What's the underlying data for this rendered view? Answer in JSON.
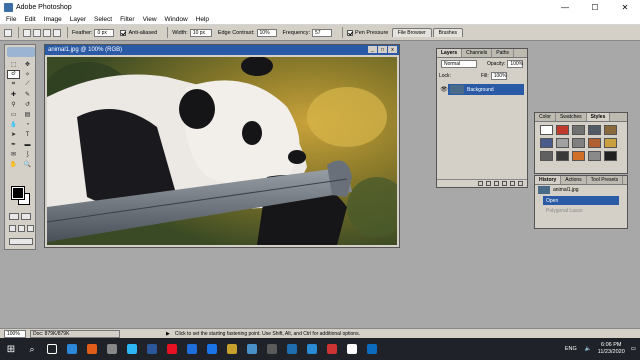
{
  "app": {
    "title": "Adobe Photoshop"
  },
  "window_controls": {
    "minimize": "—",
    "maximize": "☐",
    "close": "✕"
  },
  "menu": [
    "File",
    "Edit",
    "Image",
    "Layer",
    "Select",
    "Filter",
    "View",
    "Window",
    "Help"
  ],
  "options_bar": {
    "feather_label": "Feather:",
    "feather_value": "0 px",
    "antialiased_label": "Anti-aliased",
    "width_label": "Width:",
    "width_value": "10 px",
    "edge_contrast_label": "Edge Contrast:",
    "edge_contrast_value": "10%",
    "frequency_label": "Frequency:",
    "frequency_value": "57",
    "pen_pressure_label": "Pen Pressure"
  },
  "palette_well": [
    "File Browser",
    "Brushes"
  ],
  "document": {
    "title": "animal1.jpg @ 100% (RGB)",
    "controls": [
      "_",
      "□",
      "x"
    ]
  },
  "layers_panel": {
    "tabs": [
      "Layers",
      "Channels",
      "Paths"
    ],
    "blend_mode": "Normal",
    "opacity_label": "Opacity:",
    "opacity_value": "100%",
    "lock_label": "Lock:",
    "fill_label": "Fill:",
    "fill_value": "100%",
    "layer_name": "Background"
  },
  "styles_panel": {
    "tabs": [
      "Color",
      "Swatches",
      "Styles"
    ],
    "swatches": [
      "#ffffff",
      "#c0392b",
      "#707070",
      "#505a66",
      "#8a6a3a",
      "#4a5a8a",
      "#a0a0a0",
      "#808080",
      "#b06030",
      "#c8a040",
      "#606060",
      "#383838",
      "#d07028",
      "#8a8a8a",
      "#202020"
    ]
  },
  "history_panel": {
    "tabs": [
      "History",
      "Actions",
      "Tool Presets"
    ],
    "snapshot": "animal1.jpg",
    "states": [
      "Open",
      "Polygonal Lasso"
    ]
  },
  "status_bar": {
    "zoom": "100%",
    "doc": "Doc: 879K/879K",
    "hint": "Click to set the starting fastening point.  Use Shift, Alt, and Ctrl for additional options."
  },
  "taskbar": {
    "time": "6:06 PM",
    "date": "11/23/2020",
    "lang": "ENG",
    "icon_colors": [
      "#ffffff",
      "#2b88d8",
      "#e25c1a",
      "#888888",
      "#2db6f5",
      "#2b579a",
      "#e81123",
      "#1e6fd9",
      "#1b73e8",
      "#c7a12b",
      "#4a90c8",
      "#5a5a5a",
      "#1f6fb0",
      "#2a8ad4",
      "#cc3333",
      "#ffffff",
      "#0b6cbf"
    ]
  },
  "colors": {
    "accent": "#2a5aa5",
    "chrome": "#d4d0c8"
  }
}
